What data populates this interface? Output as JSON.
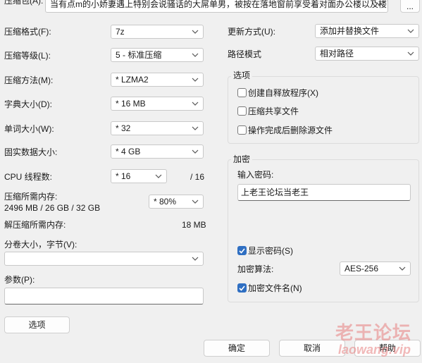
{
  "archive_path": {
    "label": "压缩包(A):",
    "value": "当有点m的小娇妻遇上特别会说骚话的大屌单男，被按在落地窗前享受着对面办公楼以及楼下行人的注",
    "browse_label": "..."
  },
  "left": {
    "format": {
      "label": "压缩格式(F):",
      "value": "7z"
    },
    "level": {
      "label": "压缩等级(L):",
      "value": "5 - 标准压缩"
    },
    "method": {
      "label": "压缩方法(M):",
      "value": "* LZMA2"
    },
    "dict": {
      "label": "字典大小(D):",
      "value": "* 16 MB"
    },
    "word": {
      "label": "单词大小(W):",
      "value": "* 32"
    },
    "solid": {
      "label": "固实数据大小:",
      "value": "* 4 GB"
    },
    "threads": {
      "label": "CPU 线程数:",
      "value": "* 16",
      "total": "/ 16"
    },
    "mem_compress": {
      "label": "压缩所需内存:",
      "detail": "2496 MB / 26 GB / 32 GB",
      "value": "* 80%"
    },
    "mem_decompress": {
      "label": "解压缩所需内存:",
      "value": "18 MB"
    },
    "split": {
      "label": "分卷大小，字节(V):",
      "value": ""
    },
    "params": {
      "label": "参数(P):",
      "value": ""
    },
    "options_button": "选项"
  },
  "right": {
    "update": {
      "label": "更新方式(U):",
      "value": "添加并替换文件"
    },
    "path_mode": {
      "label": "路径模式",
      "value": "相对路径"
    },
    "options_group": {
      "title": "选项",
      "sfx": {
        "label": "创建自释放程序(X)",
        "checked": false
      },
      "shared": {
        "label": "压缩共享文件",
        "checked": false
      },
      "delete": {
        "label": "操作完成后删除源文件",
        "checked": false
      }
    },
    "encrypt_group": {
      "title": "加密",
      "password_label": "输入密码:",
      "password_value": "上老王论坛当老王",
      "show_password": {
        "label": "显示密码(S)",
        "checked": true
      },
      "method": {
        "label": "加密算法:",
        "value": "AES-256"
      },
      "encrypt_names": {
        "label": "加密文件名(N)",
        "checked": true
      }
    }
  },
  "buttons": {
    "ok": "确定",
    "cancel": "取消",
    "help": "帮助"
  },
  "watermark": {
    "line1": "老王论坛",
    "line2": "laowang.vip"
  },
  "colors": {
    "background": "#f0f0f0",
    "checkbox_on": "#2f6fc2",
    "watermark": "#e88080"
  }
}
